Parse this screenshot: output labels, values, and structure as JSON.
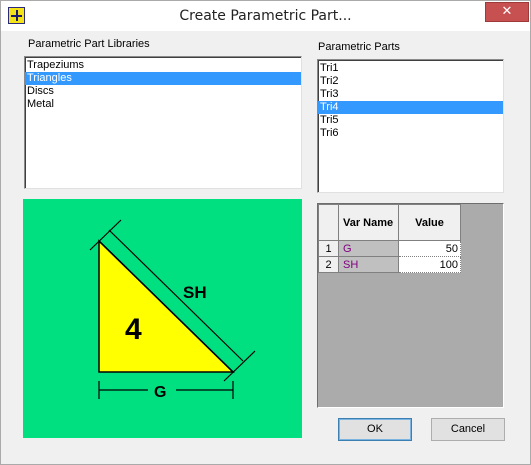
{
  "window": {
    "title": "Create Parametric Part...",
    "close_glyph": "✕"
  },
  "libraries": {
    "label": "Parametric Part Libraries",
    "items": [
      "Trapeziums",
      "Triangles",
      "Discs",
      "Metal"
    ],
    "selected": "Triangles"
  },
  "parts": {
    "label": "Parametric Parts",
    "items": [
      "Tri1",
      "Tri2",
      "Tri3",
      "Tri4",
      "Tri5",
      "Tri6"
    ],
    "selected": "Tri4"
  },
  "preview": {
    "background": "#00e080",
    "fill": "#ffff00",
    "number": "4",
    "label_hypotenuse": "SH",
    "label_base": "G"
  },
  "grid": {
    "headers": [
      "Var Name",
      "Value"
    ],
    "rows": [
      {
        "num": "1",
        "name": "G",
        "value": "50"
      },
      {
        "num": "2",
        "name": "SH",
        "value": "100"
      }
    ]
  },
  "buttons": {
    "ok": "OK",
    "cancel": "Cancel"
  }
}
